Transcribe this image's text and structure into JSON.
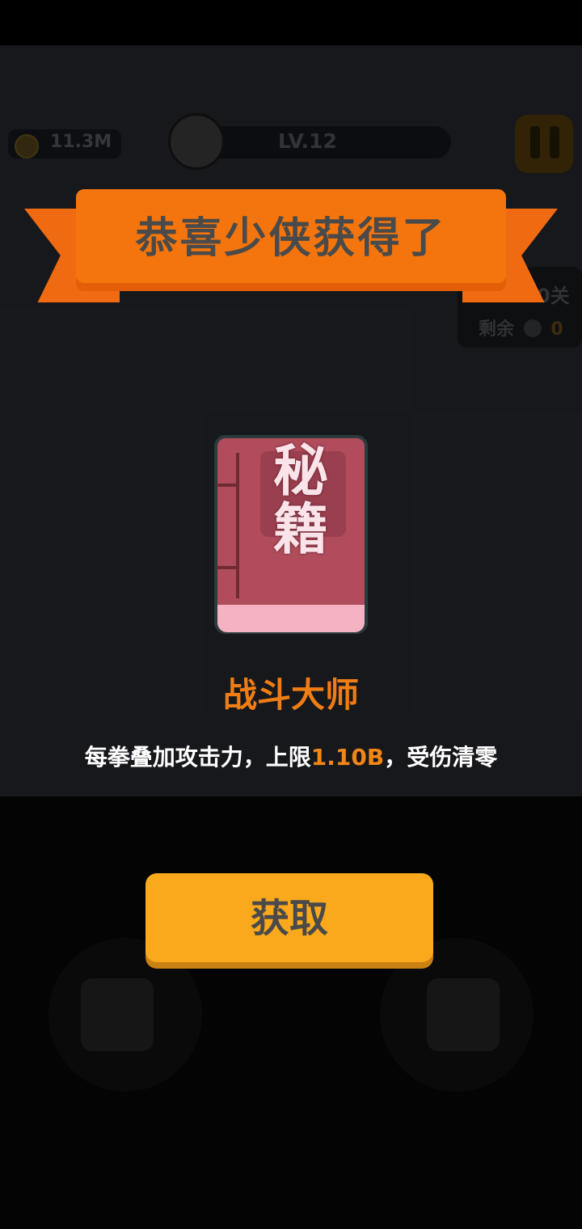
{
  "hud": {
    "coins": "11.3M",
    "level": "LV.12",
    "stage_suffix": "0关",
    "remain_label": "剩余",
    "remain_count": "0"
  },
  "reward_dialog": {
    "title": "恭喜少侠获得了",
    "item_icon_text": "秘籍",
    "item_name": "战斗大师",
    "description_prefix": "每拳叠加攻击力，上限",
    "description_value": "1.10B",
    "description_suffix": "，受伤清零",
    "claim_button": "获取"
  },
  "colors": {
    "ribbon": "#f4750d",
    "item_name": "#f07d13",
    "highlight": "#f28616",
    "button": "#f9a91b",
    "book": "#b04c5c"
  },
  "icons": [
    "coin-icon",
    "avatar-icon",
    "pause-icon",
    "skull-icon",
    "book-icon",
    "left-arrow-icon",
    "right-arrow-icon"
  ]
}
